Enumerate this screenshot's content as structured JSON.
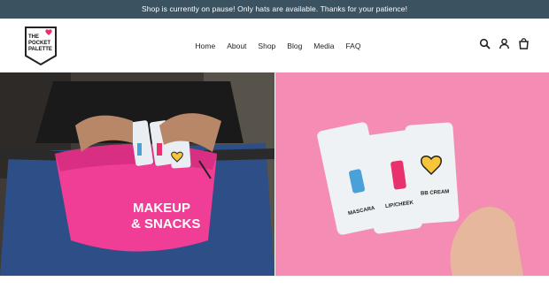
{
  "announcement": {
    "text": "Shop is currently on pause! Only hats are available. Thanks for your patience!"
  },
  "brand": {
    "logo_lines": [
      "THE",
      "POCKET",
      "PALETTE"
    ]
  },
  "nav": {
    "items": [
      "Home",
      "About",
      "Shop",
      "Blog",
      "Media",
      "FAQ"
    ]
  },
  "header_icons": [
    "search-icon",
    "account-icon",
    "cart-icon"
  ],
  "hero": {
    "left_bag_text_line1": "MAKEUP",
    "left_bag_text_line2": "& SNACKS",
    "packet_labels": [
      "MASCARA",
      "LIP/CHEEK",
      "BB CREAM"
    ]
  },
  "colors": {
    "announcement_bg": "#3b5261",
    "brand_pink": "#e8326e",
    "hero_right_bg": "#f58cb3"
  }
}
